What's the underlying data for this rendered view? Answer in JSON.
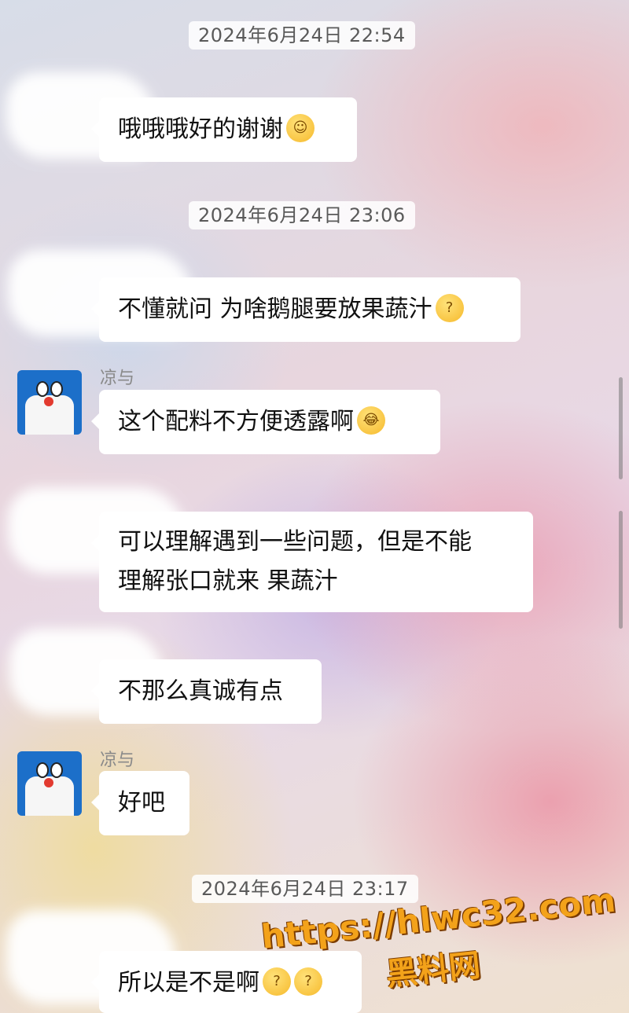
{
  "messages_view": {
    "timestamps": [
      "2024年6月24日 22:54",
      "2024年6月24日 23:06",
      "2024年6月24日 23:17"
    ],
    "contact_name": "凉与",
    "messages": [
      {
        "text": "哦哦哦好的谢谢",
        "emoji": "relieved-face-icon"
      },
      {
        "text": "不懂就问 为啥鹅腿要放果蔬汁",
        "emoji": "thinking-face-icon"
      },
      {
        "text": "这个配料不方便透露啊",
        "emoji": "crying-laughing-face-icon"
      },
      {
        "line1": "可以理解遇到一些问题，但是不能",
        "line2": "理解张口就来 果蔬汁"
      },
      {
        "text": "不那么真诚有点"
      },
      {
        "text": "好吧"
      },
      {
        "text": "所以是不是啊",
        "emojis": [
          "thinking-face-icon",
          "thinking-face-icon"
        ]
      }
    ]
  },
  "watermark": {
    "url": "https://hlwc32.com",
    "name": "黑料网"
  }
}
